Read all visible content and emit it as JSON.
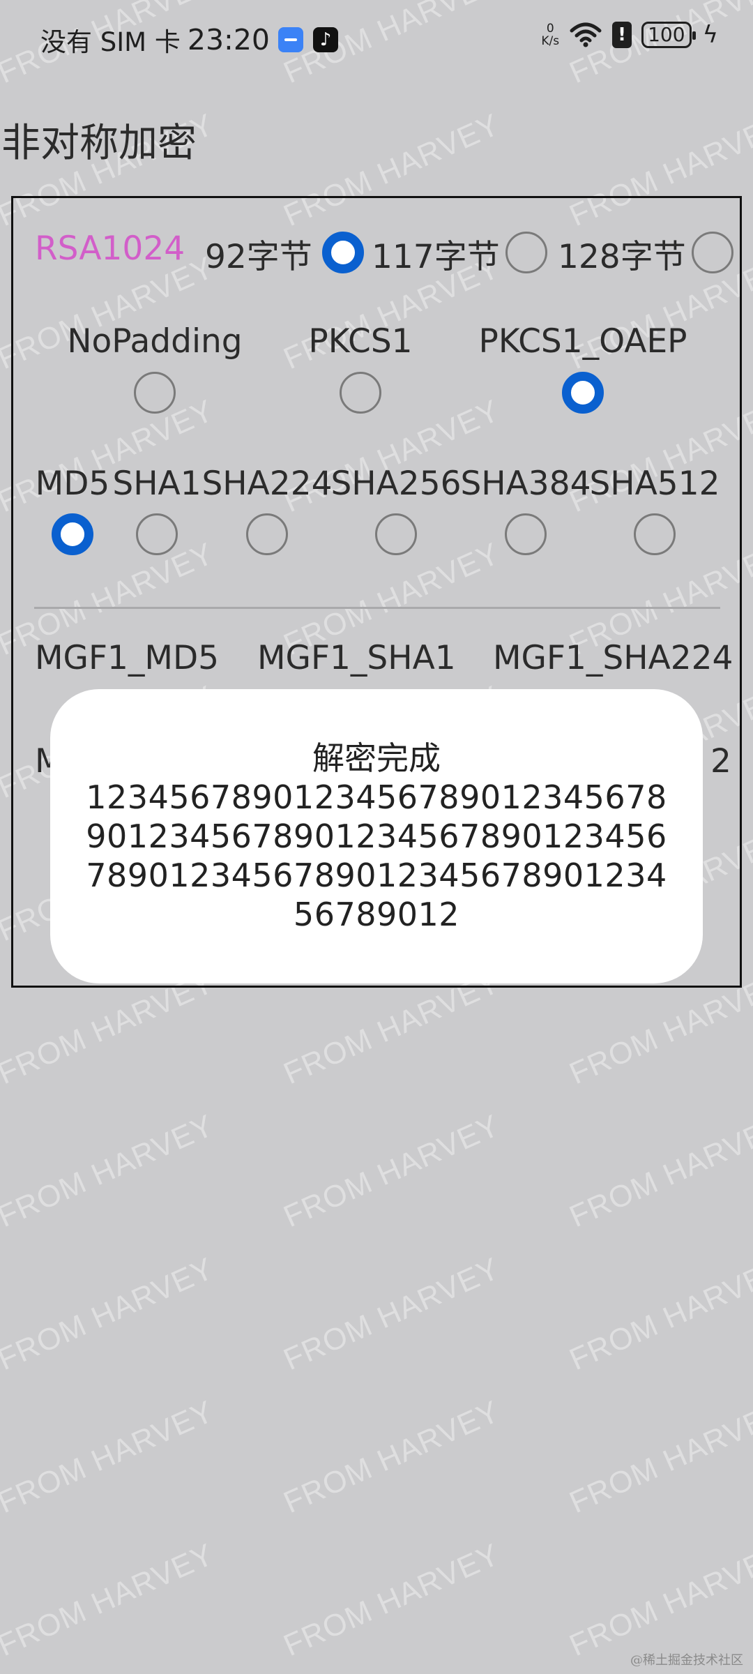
{
  "status_bar": {
    "carrier": "没有 SIM 卡",
    "time": "23:20",
    "net_speed_value": "0",
    "net_speed_unit": "K/s",
    "battery": "100",
    "alert_glyph": "!"
  },
  "watermark_text": "FROM HARVEY",
  "page": {
    "title": "非对称加密"
  },
  "key_row": {
    "algorithm": "RSA1024",
    "options": [
      {
        "label": "92字节",
        "checked": true
      },
      {
        "label": "117字节",
        "checked": false
      },
      {
        "label": "128字节",
        "checked": false
      }
    ]
  },
  "padding_row": {
    "options": [
      {
        "label": "NoPadding",
        "checked": false
      },
      {
        "label": "PKCS1",
        "checked": false
      },
      {
        "label": "PKCS1_OAEP",
        "checked": true
      }
    ]
  },
  "digest_row": {
    "options": [
      {
        "label": "MD5",
        "checked": true
      },
      {
        "label": "SHA1",
        "checked": false
      },
      {
        "label": "SHA224",
        "checked": false
      },
      {
        "label": "SHA256",
        "checked": false
      },
      {
        "label": "SHA384",
        "checked": false
      },
      {
        "label": "SHA512",
        "checked": false
      }
    ]
  },
  "mgf_row": {
    "labels": [
      "MGF1_MD5",
      "MGF1_SHA1",
      "MGF1_SHA224"
    ]
  },
  "mgf_row2": {
    "left_fragment": "M",
    "right_fragment": "2"
  },
  "toast": {
    "title": "解密完成",
    "lines": [
      "1234567890123456789012345678",
      "9012345678901234567890123456",
      "7890123456789012345678901234",
      "56789012"
    ]
  },
  "footer": {
    "mark": "@稀土掘金技术社区"
  },
  "colors": {
    "background": "#cbcbcd",
    "accent": "#0a60cf",
    "algorithm": "#d25ec9",
    "toast_bg": "#ffffff"
  }
}
